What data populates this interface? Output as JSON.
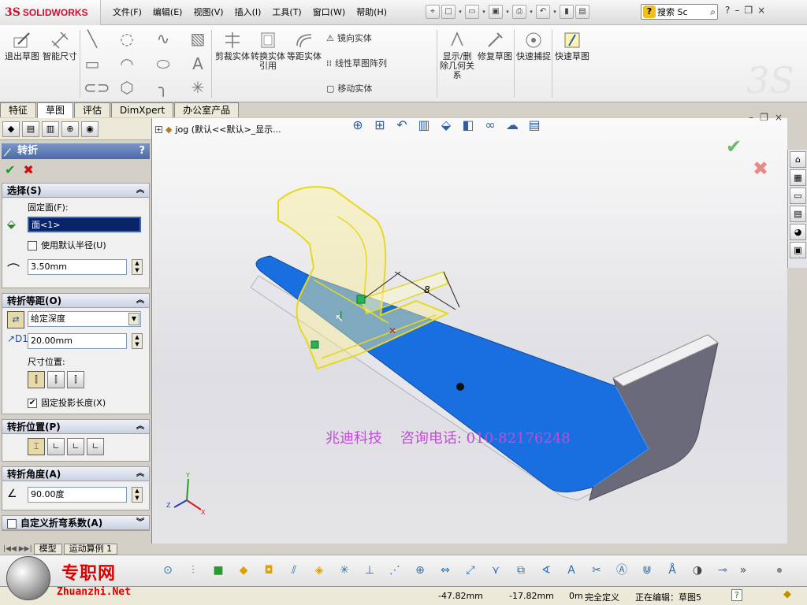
{
  "app": {
    "logo_prefix": "3S",
    "logo_name": "SOLIDWORKS"
  },
  "menu": [
    "文件(F)",
    "编辑(E)",
    "视图(V)",
    "插入(I)",
    "工具(T)",
    "窗口(W)",
    "帮助(H)"
  ],
  "quick_access": [
    "pin-icon",
    "new-icon",
    "open-icon",
    "save-icon",
    "print-icon",
    "undo-icon",
    "rebuild-icon",
    "options-icon"
  ],
  "search": {
    "badge": "?",
    "placeholder": "搜索 Sc"
  },
  "window_controls": {
    "help": "?",
    "minimize": "–",
    "restore": "❐",
    "close": "×"
  },
  "ribbon": {
    "exit_sketch": "退出草图",
    "smart_dim": "智能尺寸",
    "trim": "剪裁实体",
    "convert": "转换实体引用",
    "offset": "等距实体",
    "mirror": "镜向实体",
    "linear_pattern": "线性草图阵列",
    "move": "移动实体",
    "display_relations": "显示/删除几何关系",
    "repair": "修复草图",
    "quick_snap": "快速捕捉",
    "rapid_sketch": "快速草图"
  },
  "tabs": [
    {
      "label": "特征"
    },
    {
      "label": "草图",
      "active": true
    },
    {
      "label": "评估"
    },
    {
      "label": "DimXpert"
    },
    {
      "label": "办公室产品"
    }
  ],
  "pm": {
    "title": "转折",
    "help": "?",
    "ok": "✔",
    "cancel": "✖",
    "selection": {
      "header": "选择(S)",
      "fixed_face_label": "固定面(F):",
      "fixed_face_value": "面<1>",
      "use_default_radius": "使用默认半径(U)",
      "radius": "3.50mm"
    },
    "jog_offset": {
      "header": "转折等距(O)",
      "end_condition": "给定深度",
      "distance": "20.00mm",
      "dim_position_label": "尺寸位置:",
      "fix_projected": "固定投影长度(X)"
    },
    "jog_position": {
      "header": "转折位置(P)"
    },
    "jog_angle": {
      "header": "转折角度(A)",
      "angle": "90.00度"
    },
    "custom_bend": {
      "header": "自定义折弯系数(A)"
    }
  },
  "view": {
    "tree_label": "jog  (默认<<默认>_显示...",
    "dimension": "8",
    "watermark": "兆迪科技    咨询电话: 010-82176248"
  },
  "bottom_tabs": [
    "模型",
    "运动算例 1"
  ],
  "site": {
    "cn": "专职网",
    "url": "Zhuanzhi.Net"
  },
  "status": {
    "x": "-47.82mm",
    "y": "-17.82mm",
    "z": "0m",
    "definition": "完全定义",
    "editing": "正在编辑：草图5",
    "help": "?"
  }
}
